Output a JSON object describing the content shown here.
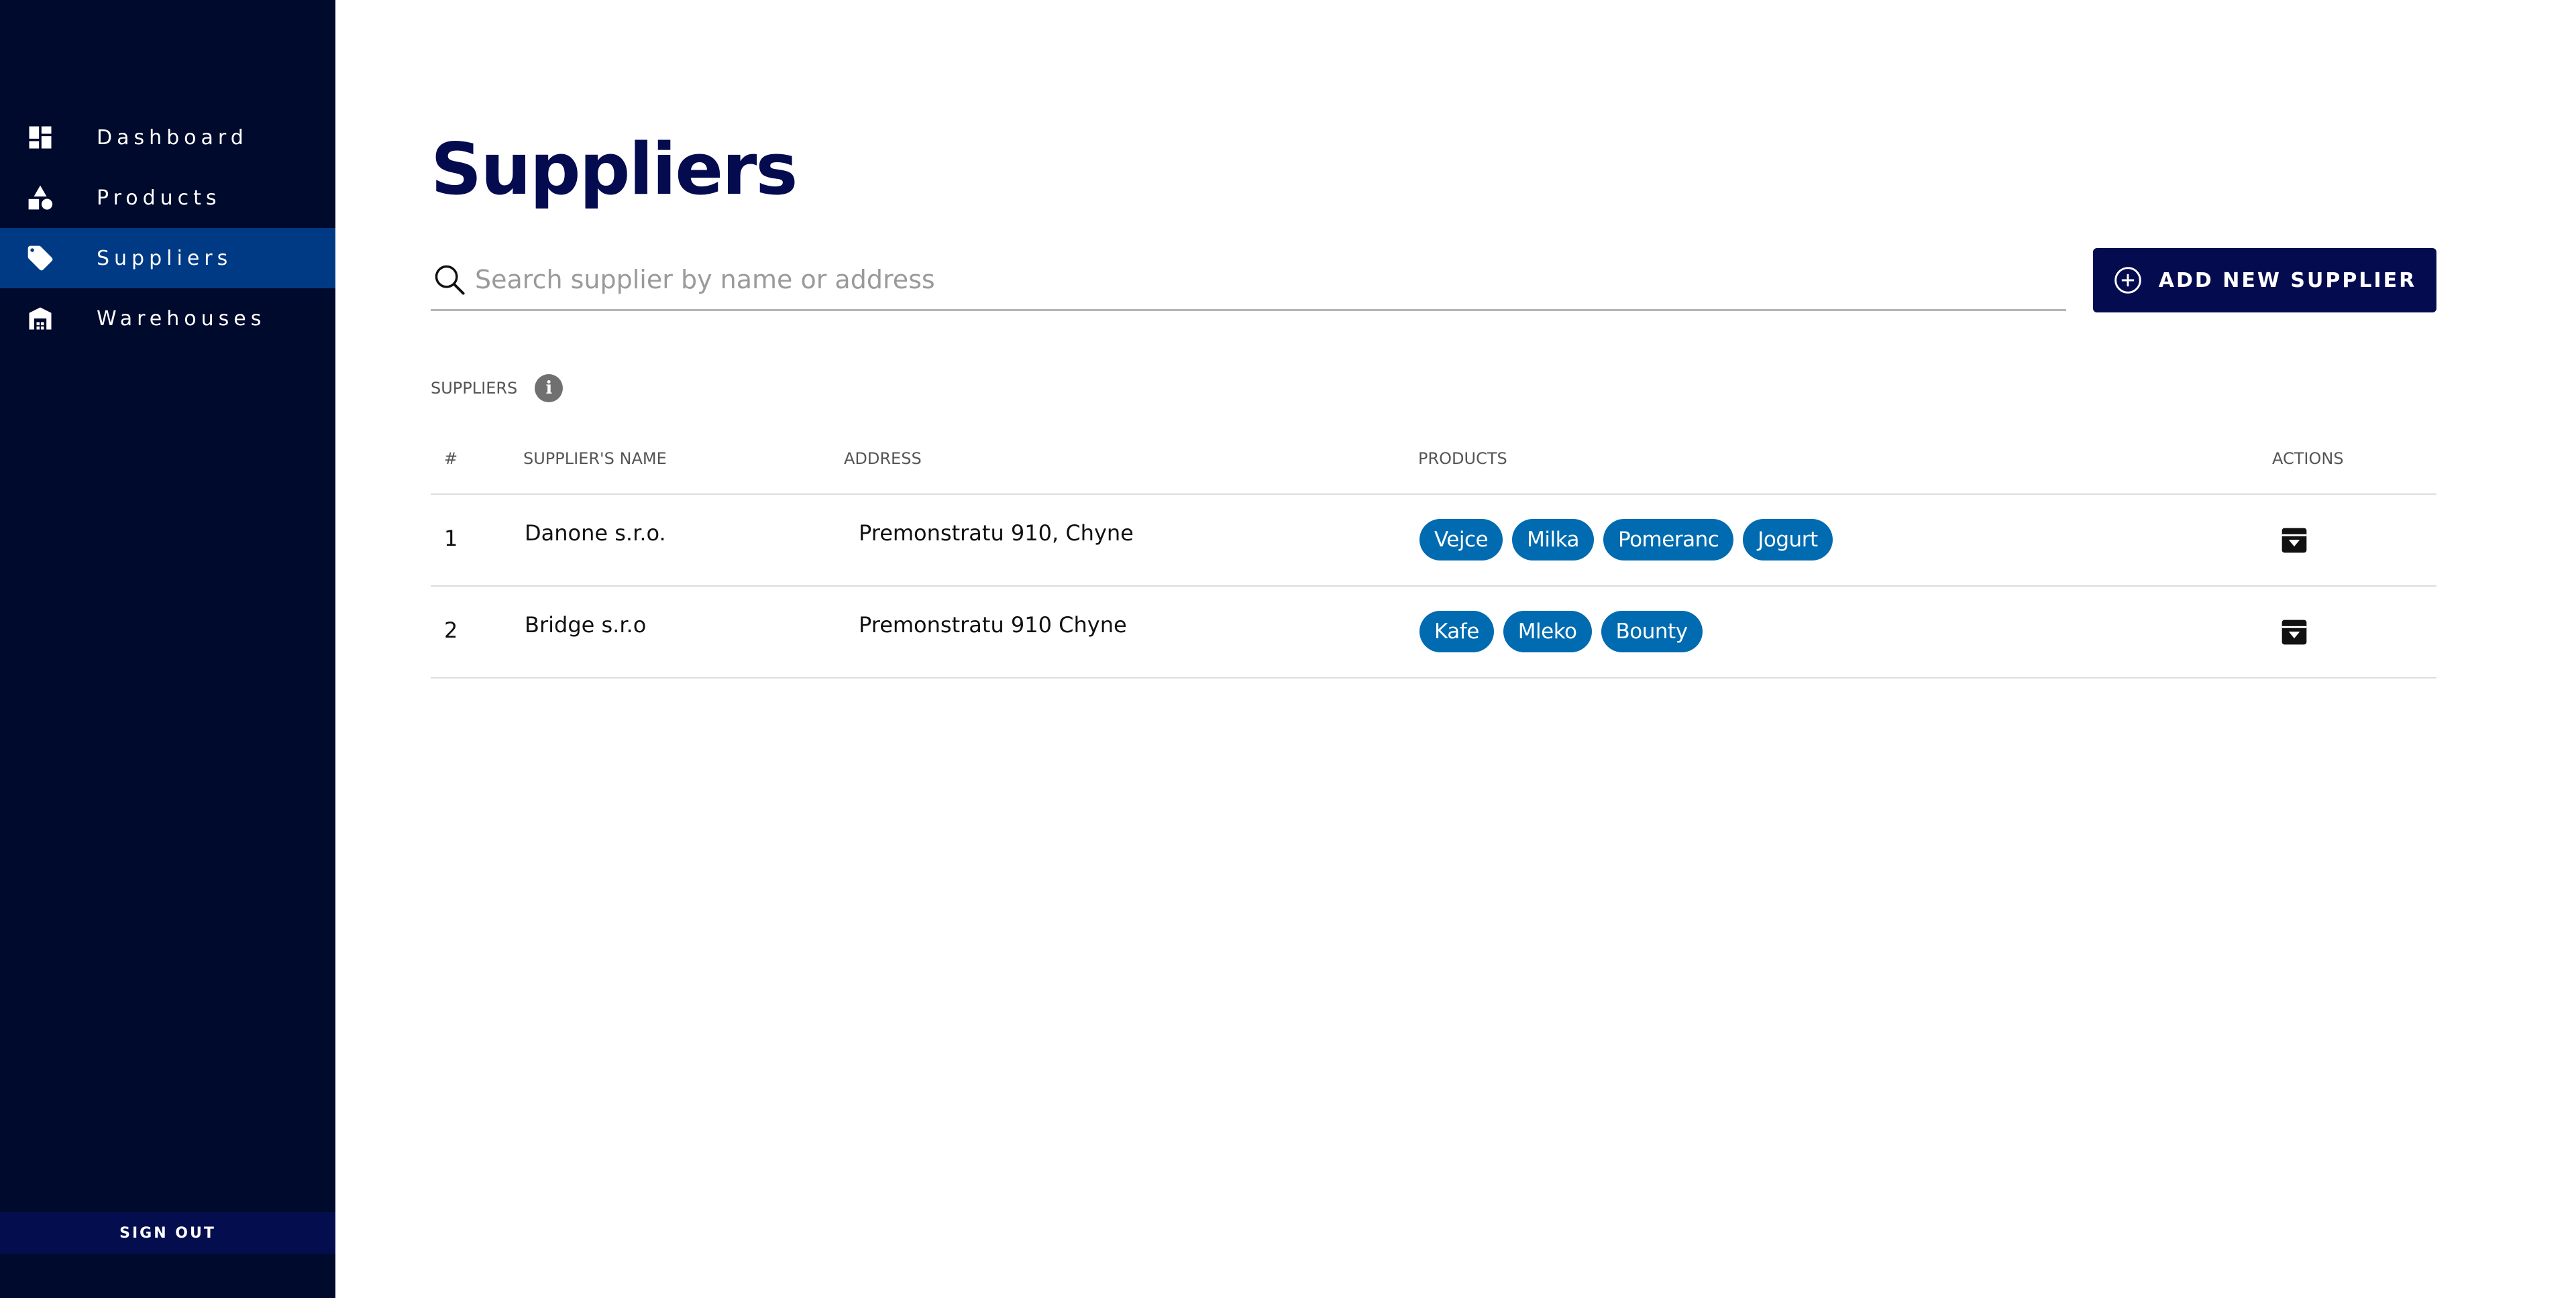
{
  "sidebar": {
    "items": [
      {
        "label": "Dashboard",
        "icon": "dashboard-icon",
        "active": false
      },
      {
        "label": "Products",
        "icon": "shapes-icon",
        "active": false
      },
      {
        "label": "Suppliers",
        "icon": "tag-icon",
        "active": true
      },
      {
        "label": "Warehouses",
        "icon": "warehouse-icon",
        "active": false
      }
    ],
    "sign_out_label": "SIGN OUT"
  },
  "page": {
    "title": "Suppliers"
  },
  "search": {
    "placeholder": "Search supplier by name or address",
    "value": ""
  },
  "add_button": {
    "label": "ADD NEW SUPPLIER",
    "icon": "plus-circle-icon"
  },
  "section": {
    "label": "SUPPLIERS",
    "info_icon_glyph": "i"
  },
  "table": {
    "headers": {
      "num": "#",
      "name": "SUPPLIER'S NAME",
      "address": "ADDRESS",
      "products": "PRODUCTS",
      "actions": "ACTIONS"
    },
    "rows": [
      {
        "num": "1",
        "name": "Danone s.r.o.",
        "address": "Premonstratu 910, Chyne",
        "products": [
          "Vejce",
          "Milka",
          "Pomeranc",
          "Jogurt"
        ],
        "action_icon": "archive-icon"
      },
      {
        "num": "2",
        "name": "Bridge s.r.o",
        "address": "Premonstratu 910 Chyne",
        "products": [
          "Kafe",
          "Mleko",
          "Bounty"
        ],
        "action_icon": "archive-icon"
      }
    ]
  },
  "colors": {
    "sidebar_bg": "#000a2c",
    "sidebar_active": "#003a84",
    "primary_dark": "#040b4f",
    "chip_blue": "#006bb0"
  }
}
